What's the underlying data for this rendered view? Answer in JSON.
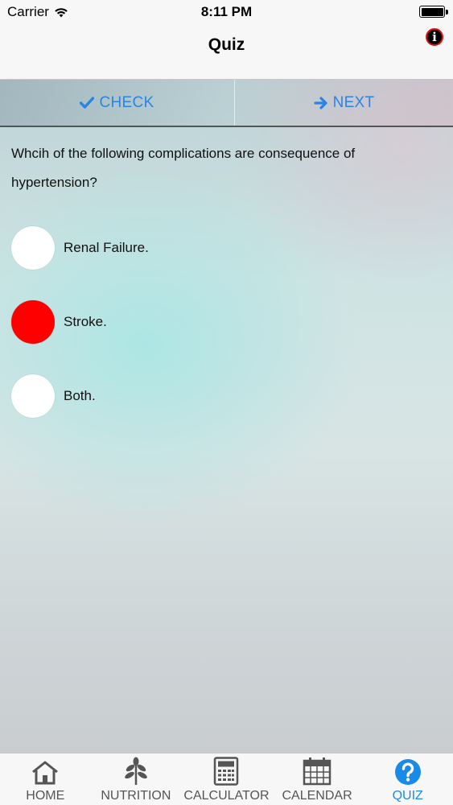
{
  "status_bar": {
    "carrier": "Carrier",
    "time": "8:11 PM"
  },
  "nav": {
    "title": "Quiz",
    "info_icon": "info-icon"
  },
  "actions": {
    "check_label": "CHECK",
    "next_label": "NEXT",
    "accent_color": "#2a84e6"
  },
  "question": {
    "text": "Whcih of the following complications are consequence of hypertension?",
    "options": [
      {
        "label": "Renal Failure.",
        "selected": false
      },
      {
        "label": "Stroke.",
        "selected": true
      },
      {
        "label": "Both.",
        "selected": false
      }
    ],
    "selected_color": "#ff0000"
  },
  "tabs": {
    "items": [
      {
        "label": "HOME",
        "icon": "home-icon",
        "active": false
      },
      {
        "label": "NUTRITION",
        "icon": "leaf-icon",
        "active": false
      },
      {
        "label": "CALCULATOR",
        "icon": "calculator-icon",
        "active": false
      },
      {
        "label": "CALENDAR",
        "icon": "calendar-icon",
        "active": false
      },
      {
        "label": "QUIZ",
        "icon": "question-icon",
        "active": true
      }
    ],
    "active_color": "#1a8ae8"
  }
}
